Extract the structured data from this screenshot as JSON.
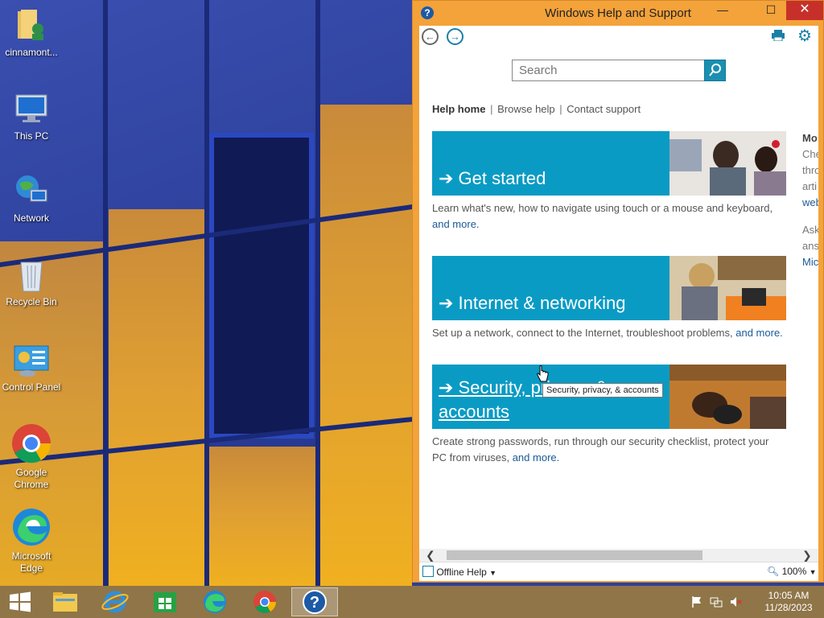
{
  "desktop": {
    "icons": [
      {
        "label": "cinnamont...",
        "icon": "user-folder-icon"
      },
      {
        "label": "This PC",
        "icon": "computer-icon"
      },
      {
        "label": "Network",
        "icon": "network-icon"
      },
      {
        "label": "Recycle Bin",
        "icon": "recycle-bin-icon"
      },
      {
        "label": "Control Panel",
        "icon": "control-panel-icon"
      },
      {
        "label": "Google Chrome",
        "icon": "chrome-icon"
      },
      {
        "label": "Microsoft Edge",
        "icon": "edge-icon"
      }
    ]
  },
  "window": {
    "title": "Windows Help and Support",
    "controls": {
      "minimize": "—",
      "maximize": "☐",
      "close": "✕"
    },
    "nav": {
      "back": "←",
      "forward": "→"
    },
    "search": {
      "placeholder": "Search"
    },
    "links": {
      "home": "Help home",
      "browse": "Browse help",
      "contact": "Contact support",
      "sep": "|"
    },
    "tiles": [
      {
        "title": "Get started",
        "desc": "Learn what's new, how to navigate using touch or a mouse and keyboard,",
        "more": "and more."
      },
      {
        "title": "Internet & networking",
        "desc": "Set up a network, connect to the Internet, troubleshoot problems,",
        "more": "and more."
      },
      {
        "title_line1": "Security, privacy, &",
        "title_line2": "accounts",
        "desc": "Create strong passwords, run through our security checklist, protect your PC from viruses,",
        "more": "and more."
      }
    ],
    "right_column": [
      "Mo",
      "Che",
      "thro",
      "arti",
      "web",
      "",
      "Ask",
      "ans",
      "Mic"
    ],
    "tooltip": "Security, privacy, & accounts",
    "status": {
      "offline_help": "Offline Help",
      "zoom": "100%"
    }
  },
  "taskbar": {
    "apps": [
      "start-button",
      "file-explorer",
      "internet-explorer",
      "store",
      "edge",
      "chrome",
      "help-and-support"
    ],
    "time": "10:05 AM",
    "date": "11/28/2023"
  },
  "colors": {
    "accent": "#0a9bc4",
    "window_frame": "#f4a23a",
    "taskbar": "#8f7548"
  }
}
